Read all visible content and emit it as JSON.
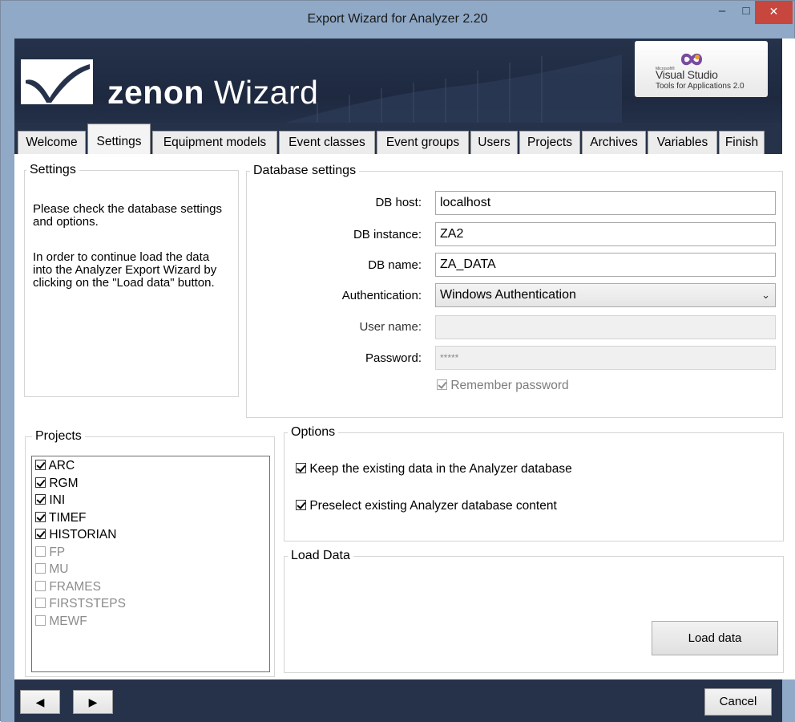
{
  "window": {
    "title": "Export Wizard for Analyzer 2.20",
    "minimize": "–",
    "maximize": "□",
    "close": "✕"
  },
  "banner": {
    "brand_bold": "zenon",
    "brand_rest": " Wizard",
    "vs_small": "Microsoft®",
    "vs_name": "Visual Studio",
    "vs_tools": "Tools for Applications 2.0"
  },
  "tabs": [
    {
      "label": "Welcome",
      "active": false
    },
    {
      "label": "Settings",
      "active": true
    },
    {
      "label": "Equipment models",
      "active": false
    },
    {
      "label": "Event classes",
      "active": false
    },
    {
      "label": "Event groups",
      "active": false
    },
    {
      "label": "Users",
      "active": false
    },
    {
      "label": "Projects",
      "active": false
    },
    {
      "label": "Archives",
      "active": false
    },
    {
      "label": "Variables",
      "active": false
    },
    {
      "label": "Finish",
      "active": false
    }
  ],
  "settings_group": {
    "legend": "Settings",
    "text1": "Please check the database settings and options.",
    "text2": "In order to continue load the data into the Analyzer Export Wizard by clicking on the \"Load data\" button."
  },
  "db_settings": {
    "legend": "Database settings",
    "host_label": "DB host:",
    "host_value": "localhost",
    "instance_label": "DB instance:",
    "instance_value": "ZA2",
    "name_label": "DB name:",
    "name_value": "ZA_DATA",
    "auth_label": "Authentication:",
    "auth_value": "Windows Authentication",
    "user_label": "User name:",
    "user_value": "",
    "password_label": "Password:",
    "password_value": "*****",
    "remember_label": "Remember password",
    "remember_checked": true
  },
  "projects": {
    "legend": "Projects",
    "items": [
      {
        "label": "ARC",
        "checked": true
      },
      {
        "label": "RGM",
        "checked": true
      },
      {
        "label": "INI",
        "checked": true
      },
      {
        "label": "TIMEF",
        "checked": true
      },
      {
        "label": "HISTORIAN",
        "checked": true
      },
      {
        "label": "FP",
        "checked": false
      },
      {
        "label": "MU",
        "checked": false
      },
      {
        "label": "FRAMES",
        "checked": false
      },
      {
        "label": "FIRSTSTEPS",
        "checked": false
      },
      {
        "label": "MEWF",
        "checked": false
      }
    ]
  },
  "options": {
    "legend": "Options",
    "keep_label": "Keep the existing data in the Analyzer database",
    "keep_checked": true,
    "preselect_label": "Preselect existing Analyzer database content",
    "preselect_checked": true
  },
  "load_data": {
    "legend": "Load Data",
    "button": "Load data"
  },
  "footer": {
    "back": "◀",
    "forward": "▶",
    "cancel": "Cancel"
  },
  "colors": {
    "titlebar": "#8fa9c7",
    "banner": "#25324a",
    "close": "#c7463d"
  }
}
